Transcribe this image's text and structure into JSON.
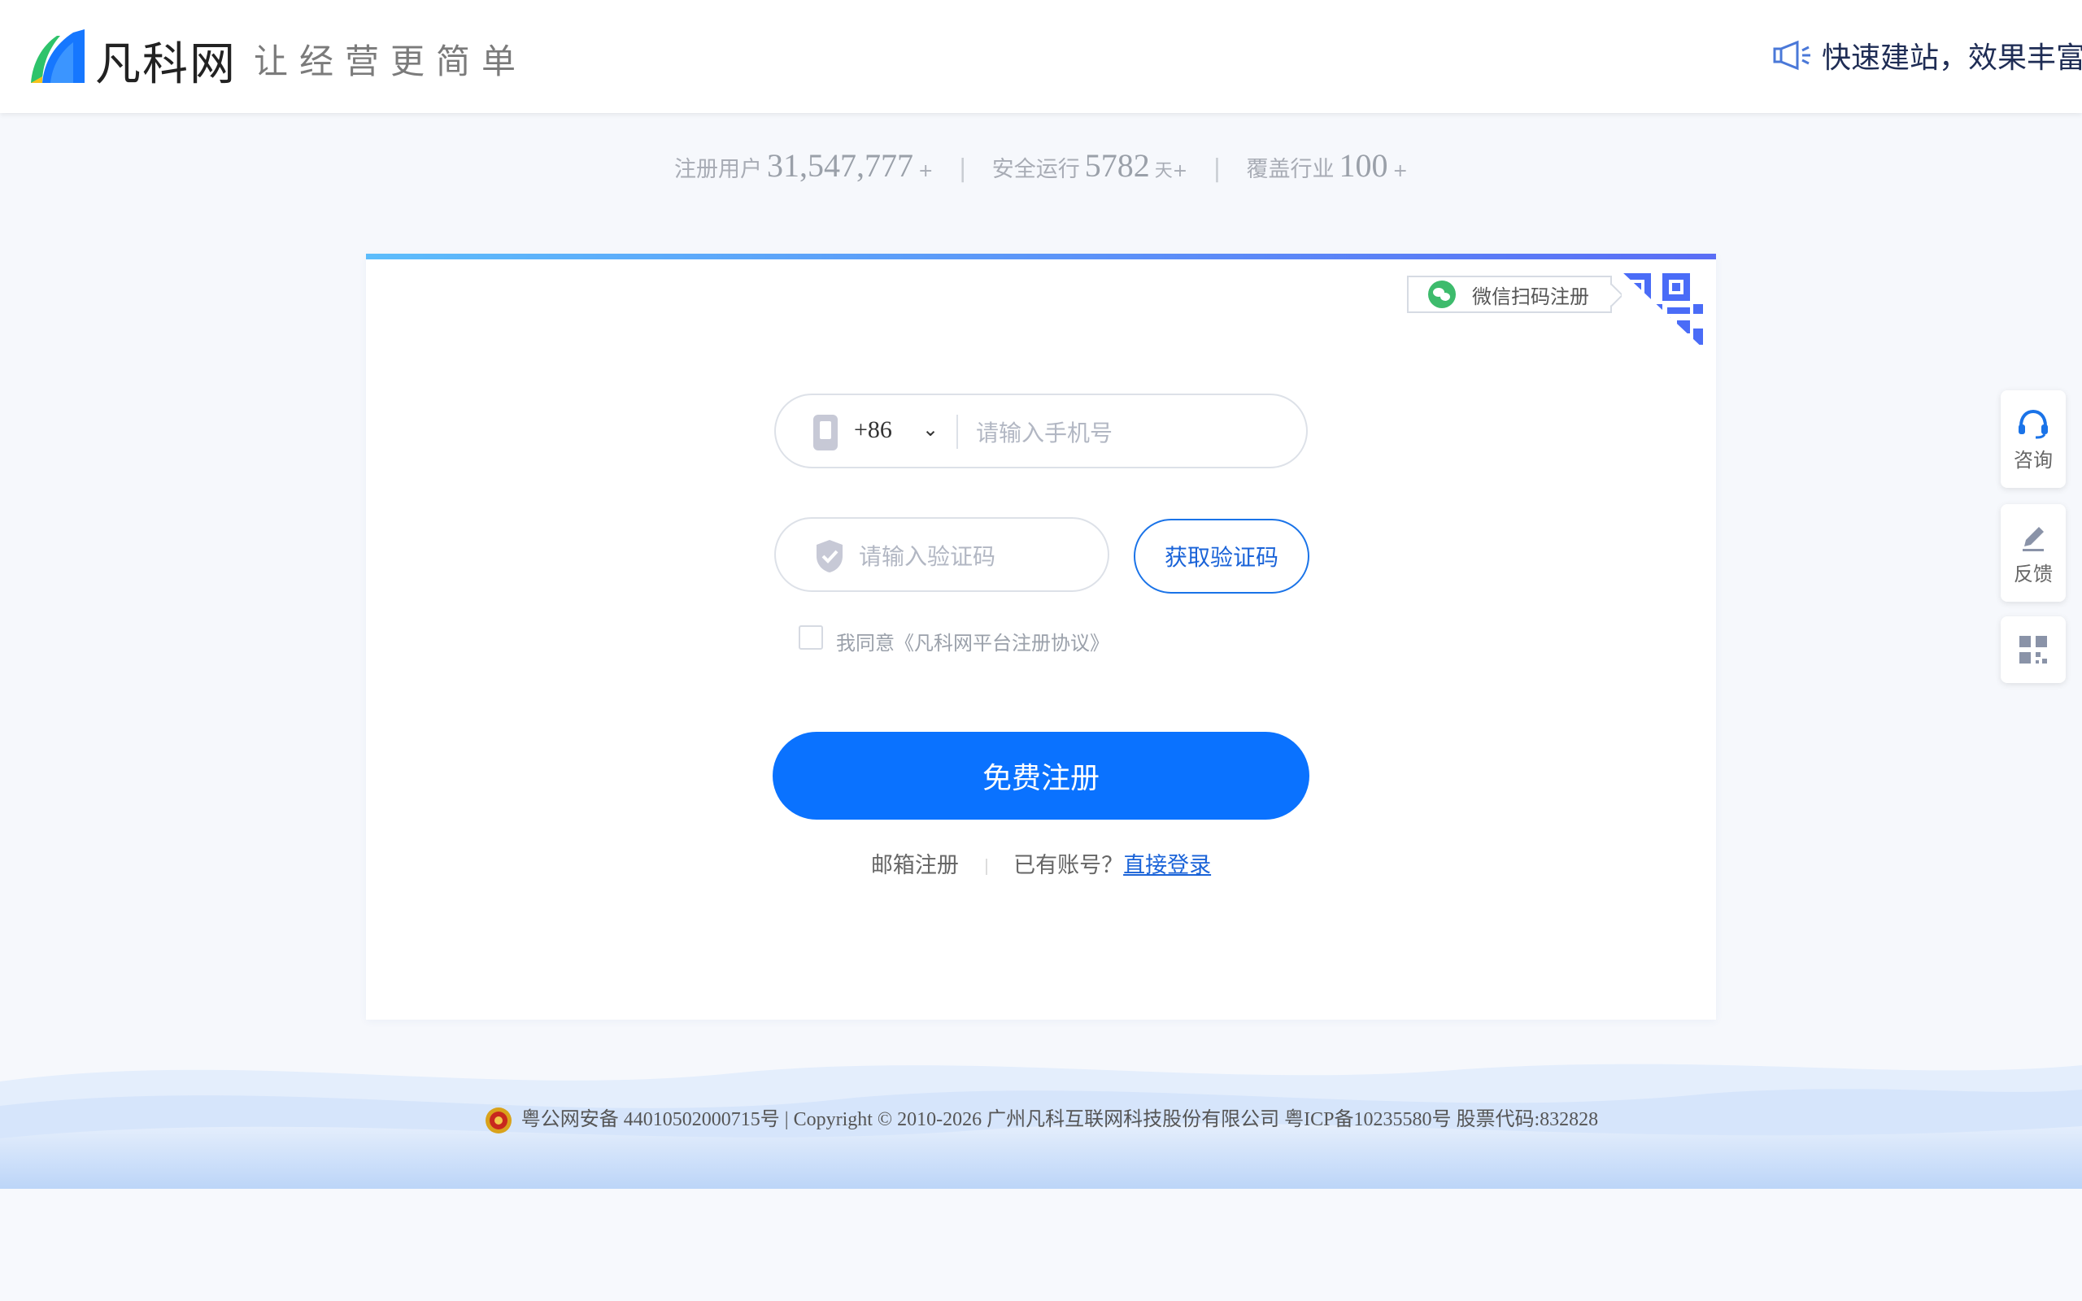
{
  "header": {
    "logo_text": "凡科网",
    "slogan": "让经营更简单",
    "promo_text": "快速建站，效果丰富",
    "promo_icon": "megaphone-icon"
  },
  "stats": [
    {
      "label": "注册用户",
      "value": "31,547,777",
      "suffix": "+"
    },
    {
      "label": "安全运行",
      "value": "5782",
      "suffix": "天+"
    },
    {
      "label": "覆盖行业",
      "value": "100",
      "suffix": "+"
    }
  ],
  "form": {
    "wechat_tip": "微信扫码注册",
    "country_code": "+86",
    "phone_placeholder": "请输入手机号",
    "code_placeholder": "请输入验证码",
    "get_code_label": "获取验证码",
    "agreement_text": "我同意《凡科网平台注册协议》",
    "register_label": "免费注册",
    "email_register": "邮箱注册",
    "has_account": "已有账号？",
    "login_link": "直接登录"
  },
  "float_menu": {
    "consult": "咨询",
    "feedback": "反馈"
  },
  "footer": {
    "text": "粤公网安备 44010502000715号 | Copyright © 2010-2026 广州凡科互联网科技股份有限公司 粤ICP备10235580号 股票代码:832828"
  },
  "colors": {
    "primary": "#0a72ff",
    "link": "#1a63d8",
    "wechat": "#3dbb6c"
  }
}
